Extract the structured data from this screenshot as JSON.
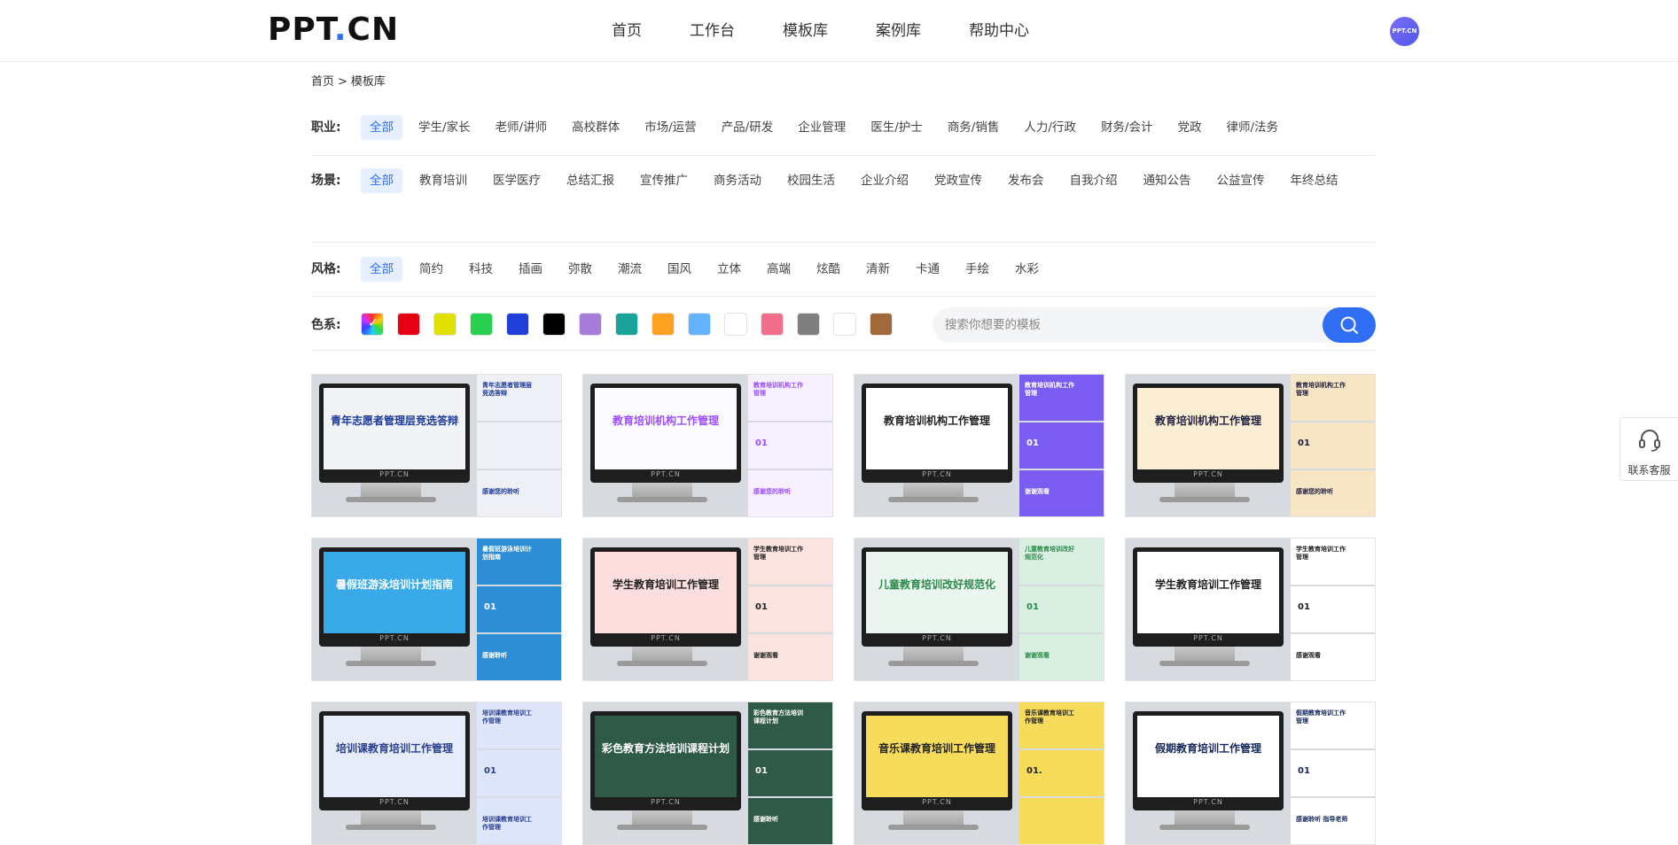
{
  "header": {
    "logo": "PPT.CN",
    "nav": [
      "首页",
      "工作台",
      "模板库",
      "案例库",
      "帮助中心"
    ],
    "avatar_text": "PPT.CN"
  },
  "breadcrumb": {
    "home": "首页",
    "sep": ">",
    "current": "模板库"
  },
  "filters": {
    "job": {
      "label": "职业:",
      "options": [
        "全部",
        "学生/家长",
        "老师/讲师",
        "高校群体",
        "市场/运营",
        "产品/研发",
        "企业管理",
        "医生/护士",
        "商务/销售",
        "人力/行政",
        "财务/会计",
        "党政",
        "律师/法务"
      ],
      "active": 0
    },
    "scene": {
      "label": "场景:",
      "options": [
        "全部",
        "教育培训",
        "医学医疗",
        "总结汇报",
        "宣传推广",
        "商务活动",
        "校园生活",
        "企业介绍",
        "党政宣传",
        "发布会",
        "自我介绍",
        "通知公告",
        "公益宣传",
        "年终总结"
      ],
      "active": 0
    },
    "style": {
      "label": "风格:",
      "options": [
        "全部",
        "简约",
        "科技",
        "插画",
        "弥散",
        "潮流",
        "国风",
        "立体",
        "高端",
        "炫酷",
        "清新",
        "卡通",
        "手绘",
        "水彩"
      ],
      "active": 0
    },
    "color": {
      "label": "色系:",
      "swatches": [
        "rainbow",
        "#e60012",
        "#e1e100",
        "#28d04f",
        "#1f3fd8",
        "#000000",
        "#a67cd9",
        "#1aa39a",
        "#ffa11f",
        "#63b3ff",
        "#ffffff",
        "#f26e8a",
        "#7f7f7f",
        "#ffffff",
        "#a1683a"
      ]
    }
  },
  "search": {
    "placeholder": "搜索你想要的模板",
    "value": ""
  },
  "templates": [
    {
      "title": "青年志愿者管理层竞选答辩",
      "screen_bg": "#f2f3f7",
      "accent": "#1b3a9b",
      "side_bg": "#eef0f6",
      "side_t1": "青年志愿者管理层竞选答辩",
      "side_num": "",
      "side_t3": "感谢您的聆听",
      "brand": "PPT.CN"
    },
    {
      "title": "教育培训机构工作管理",
      "screen_bg": "#fbfbff",
      "accent": "#9b4dff",
      "side_bg": "#f6f0ff",
      "side_t1": "教育培训机构工作管理",
      "side_num": "01",
      "side_t3": "感谢您的聆听",
      "brand": "PPT.CN"
    },
    {
      "title": "教育培训机构工作管理",
      "screen_bg": "#ffffff",
      "accent": "#222222",
      "side_bg": "#7b5cf0",
      "side_t1": "教育培训机构工作管理",
      "side_num": "01",
      "side_t3": "谢谢观看",
      "brand": "PPT.CN"
    },
    {
      "title": "教育培训机构工作管理",
      "screen_bg": "#fbeed4",
      "accent": "#222244",
      "side_bg": "#f7e6c6",
      "side_t1": "教育培训机构工作管理",
      "side_num": "01",
      "side_t3": "感谢您的聆听",
      "brand": "PPT.CN"
    },
    {
      "title": "暑假班游泳培训计划指南",
      "screen_bg": "#3aa9e8",
      "accent": "#ffffff",
      "side_bg": "#2d8ed6",
      "side_t1": "暑假班游泳培训计划指南",
      "side_num": "01",
      "side_t3": "感谢聆听",
      "brand": "PPT.CN"
    },
    {
      "title": "学生教育培训工作管理",
      "screen_bg": "#fbdedd",
      "accent": "#222222",
      "side_bg": "#fbe3e0",
      "side_t1": "学生教育培训工作管理",
      "side_num": "01",
      "side_t3": "谢谢观看",
      "brand": "PPT.CN"
    },
    {
      "title": "儿童教育培训改好规范化",
      "screen_bg": "#e9f5ee",
      "accent": "#2b8a4a",
      "side_bg": "#d9efe2",
      "side_t1": "儿童教育培训改好规范化",
      "side_num": "01",
      "side_t3": "谢谢观看",
      "brand": "PPT.CN"
    },
    {
      "title": "学生教育培训工作管理",
      "screen_bg": "#ffffff",
      "accent": "#222222",
      "side_bg": "#ffffff",
      "side_t1": "学生教育培训工作管理",
      "side_num": "01",
      "side_t3": "感谢观看",
      "brand": "PPT.CN"
    },
    {
      "title": "培训课教育培训工作管理",
      "screen_bg": "#e7ecfb",
      "accent": "#2a3f8f",
      "side_bg": "#dfe6fb",
      "side_t1": "培训课教育培训工作管理",
      "side_num": "01",
      "side_t3": "培训课教育培训工作管理",
      "brand": "PPT.CN"
    },
    {
      "title": "彩色教育方法培训课程计划",
      "screen_bg": "#2f5a47",
      "accent": "#ffffff",
      "side_bg": "#2f5a47",
      "side_t1": "彩色教育方法培训课程计划",
      "side_num": "01",
      "side_t3": "感谢聆听",
      "brand": "PPT.CN"
    },
    {
      "title": "音乐课教育培训工作管理",
      "screen_bg": "#f7dc5b",
      "accent": "#222222",
      "side_bg": "#f7dc5b",
      "side_t1": "音乐课教育培训工作管理",
      "side_num": "01.",
      "side_t3": "",
      "brand": "PPT.CN"
    },
    {
      "title": "假期教育培训工作管理",
      "screen_bg": "#ffffff",
      "accent": "#14285e",
      "side_bg": "#ffffff",
      "side_t1": "假期教育培训工作管理",
      "side_num": "01",
      "side_t3": "感谢聆听 指导老师",
      "brand": "PPT.CN"
    }
  ],
  "float": {
    "label": "联系客服"
  }
}
